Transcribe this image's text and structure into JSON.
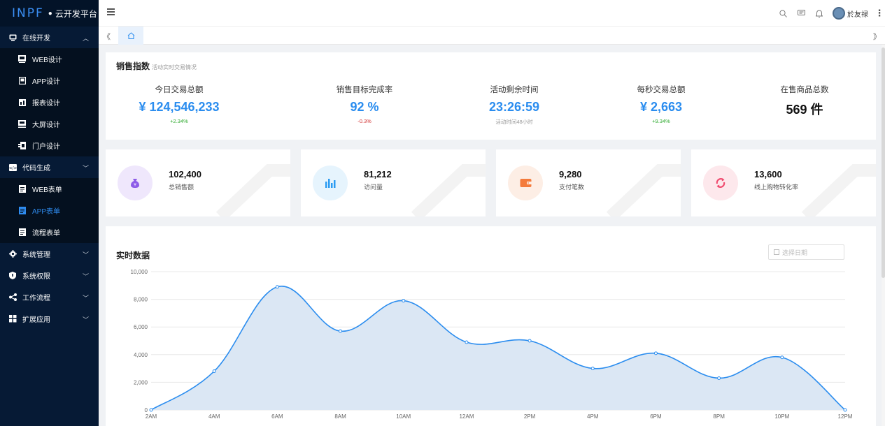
{
  "app": {
    "logo_text": "INPF",
    "platform_name": "云开发平台"
  },
  "sidebar": {
    "groups": [
      {
        "label": "在线开发",
        "icon": "monitor-icon",
        "expanded": true,
        "items": [
          {
            "label": "WEB设计",
            "icon": "web-design-icon"
          },
          {
            "label": "APP设计",
            "icon": "app-design-icon"
          },
          {
            "label": "报表设计",
            "icon": "report-design-icon"
          },
          {
            "label": "大屏设计",
            "icon": "screen-design-icon"
          },
          {
            "label": "门户设计",
            "icon": "portal-design-icon"
          }
        ]
      },
      {
        "label": "代码生成",
        "icon": "code-icon",
        "expanded": true,
        "items": [
          {
            "label": "WEB表单",
            "icon": "form-icon"
          },
          {
            "label": "APP表单",
            "icon": "form-icon",
            "active": true
          },
          {
            "label": "流程表单",
            "icon": "form-icon"
          }
        ]
      },
      {
        "label": "系统管理",
        "icon": "gear-icon",
        "expanded": false
      },
      {
        "label": "系统权限",
        "icon": "shield-icon",
        "expanded": false
      },
      {
        "label": "工作流程",
        "icon": "workflow-icon",
        "expanded": false
      },
      {
        "label": "扩展应用",
        "icon": "grid-icon",
        "expanded": false
      }
    ]
  },
  "header": {
    "user_name": "於友禄",
    "icons": [
      "search-icon",
      "message-icon",
      "bell-icon",
      "avatar",
      "more-icon"
    ]
  },
  "tabs": {
    "home_icon": "home-icon"
  },
  "sales": {
    "title": "销售指数",
    "subtitle": "活动实时交易情况",
    "kpis": [
      {
        "label": "今日交易总额",
        "value": "¥ 124,546,233",
        "change": "+2.34%",
        "value_color": "blue",
        "change_color": "green"
      },
      {
        "label": "销售目标完成率",
        "value": "92 %",
        "change": "-0.3%",
        "value_color": "blue",
        "change_color": "red"
      },
      {
        "label": "活动剩余时间",
        "value": "23:26:59",
        "change": "活动时间48小时",
        "value_color": "blue",
        "change_color": "gray"
      },
      {
        "label": "每秒交易总额",
        "value": "¥ 2,663",
        "change": "+9.34%",
        "value_color": "blue",
        "change_color": "green"
      },
      {
        "label": "在售商品总数",
        "value": "569 件",
        "change": "",
        "value_color": "black",
        "change_color": "gray"
      }
    ]
  },
  "stat_cards": [
    {
      "value": "102,400",
      "label": "总销售额",
      "icon": "money-bag-icon",
      "color": "#8d5be8",
      "bg": "#efe7fc"
    },
    {
      "value": "81,212",
      "label": "访问量",
      "icon": "bar-chart-icon",
      "color": "#2b9cf2",
      "bg": "#e6f4fd"
    },
    {
      "value": "9,280",
      "label": "支付笔数",
      "icon": "wallet-icon",
      "color": "#f47b3c",
      "bg": "#fdeee5"
    },
    {
      "value": "13,600",
      "label": "线上购物转化率",
      "icon": "refresh-icon",
      "color": "#f04a6e",
      "bg": "#fde8ec"
    }
  ],
  "realtime": {
    "title": "实时数据",
    "date_placeholder": "选择日期"
  },
  "chart_data": {
    "type": "area",
    "title": "实时数据",
    "x": [
      "2AM",
      "4AM",
      "6AM",
      "8AM",
      "10AM",
      "12AM",
      "2PM",
      "4PM",
      "6PM",
      "8PM",
      "10PM",
      "12PM"
    ],
    "series": [
      {
        "values": [
          0,
          2800,
          8900,
          5700,
          7900,
          4900,
          5000,
          3000,
          4100,
          2300,
          3800,
          0
        ]
      }
    ],
    "yticks": [
      "0",
      "2,000",
      "4,000",
      "6,000",
      "8,000",
      "10,000"
    ],
    "ylim": [
      0,
      10000
    ],
    "grid": true,
    "line_color": "#2b8def",
    "fill_color": "#dbe7f4"
  }
}
